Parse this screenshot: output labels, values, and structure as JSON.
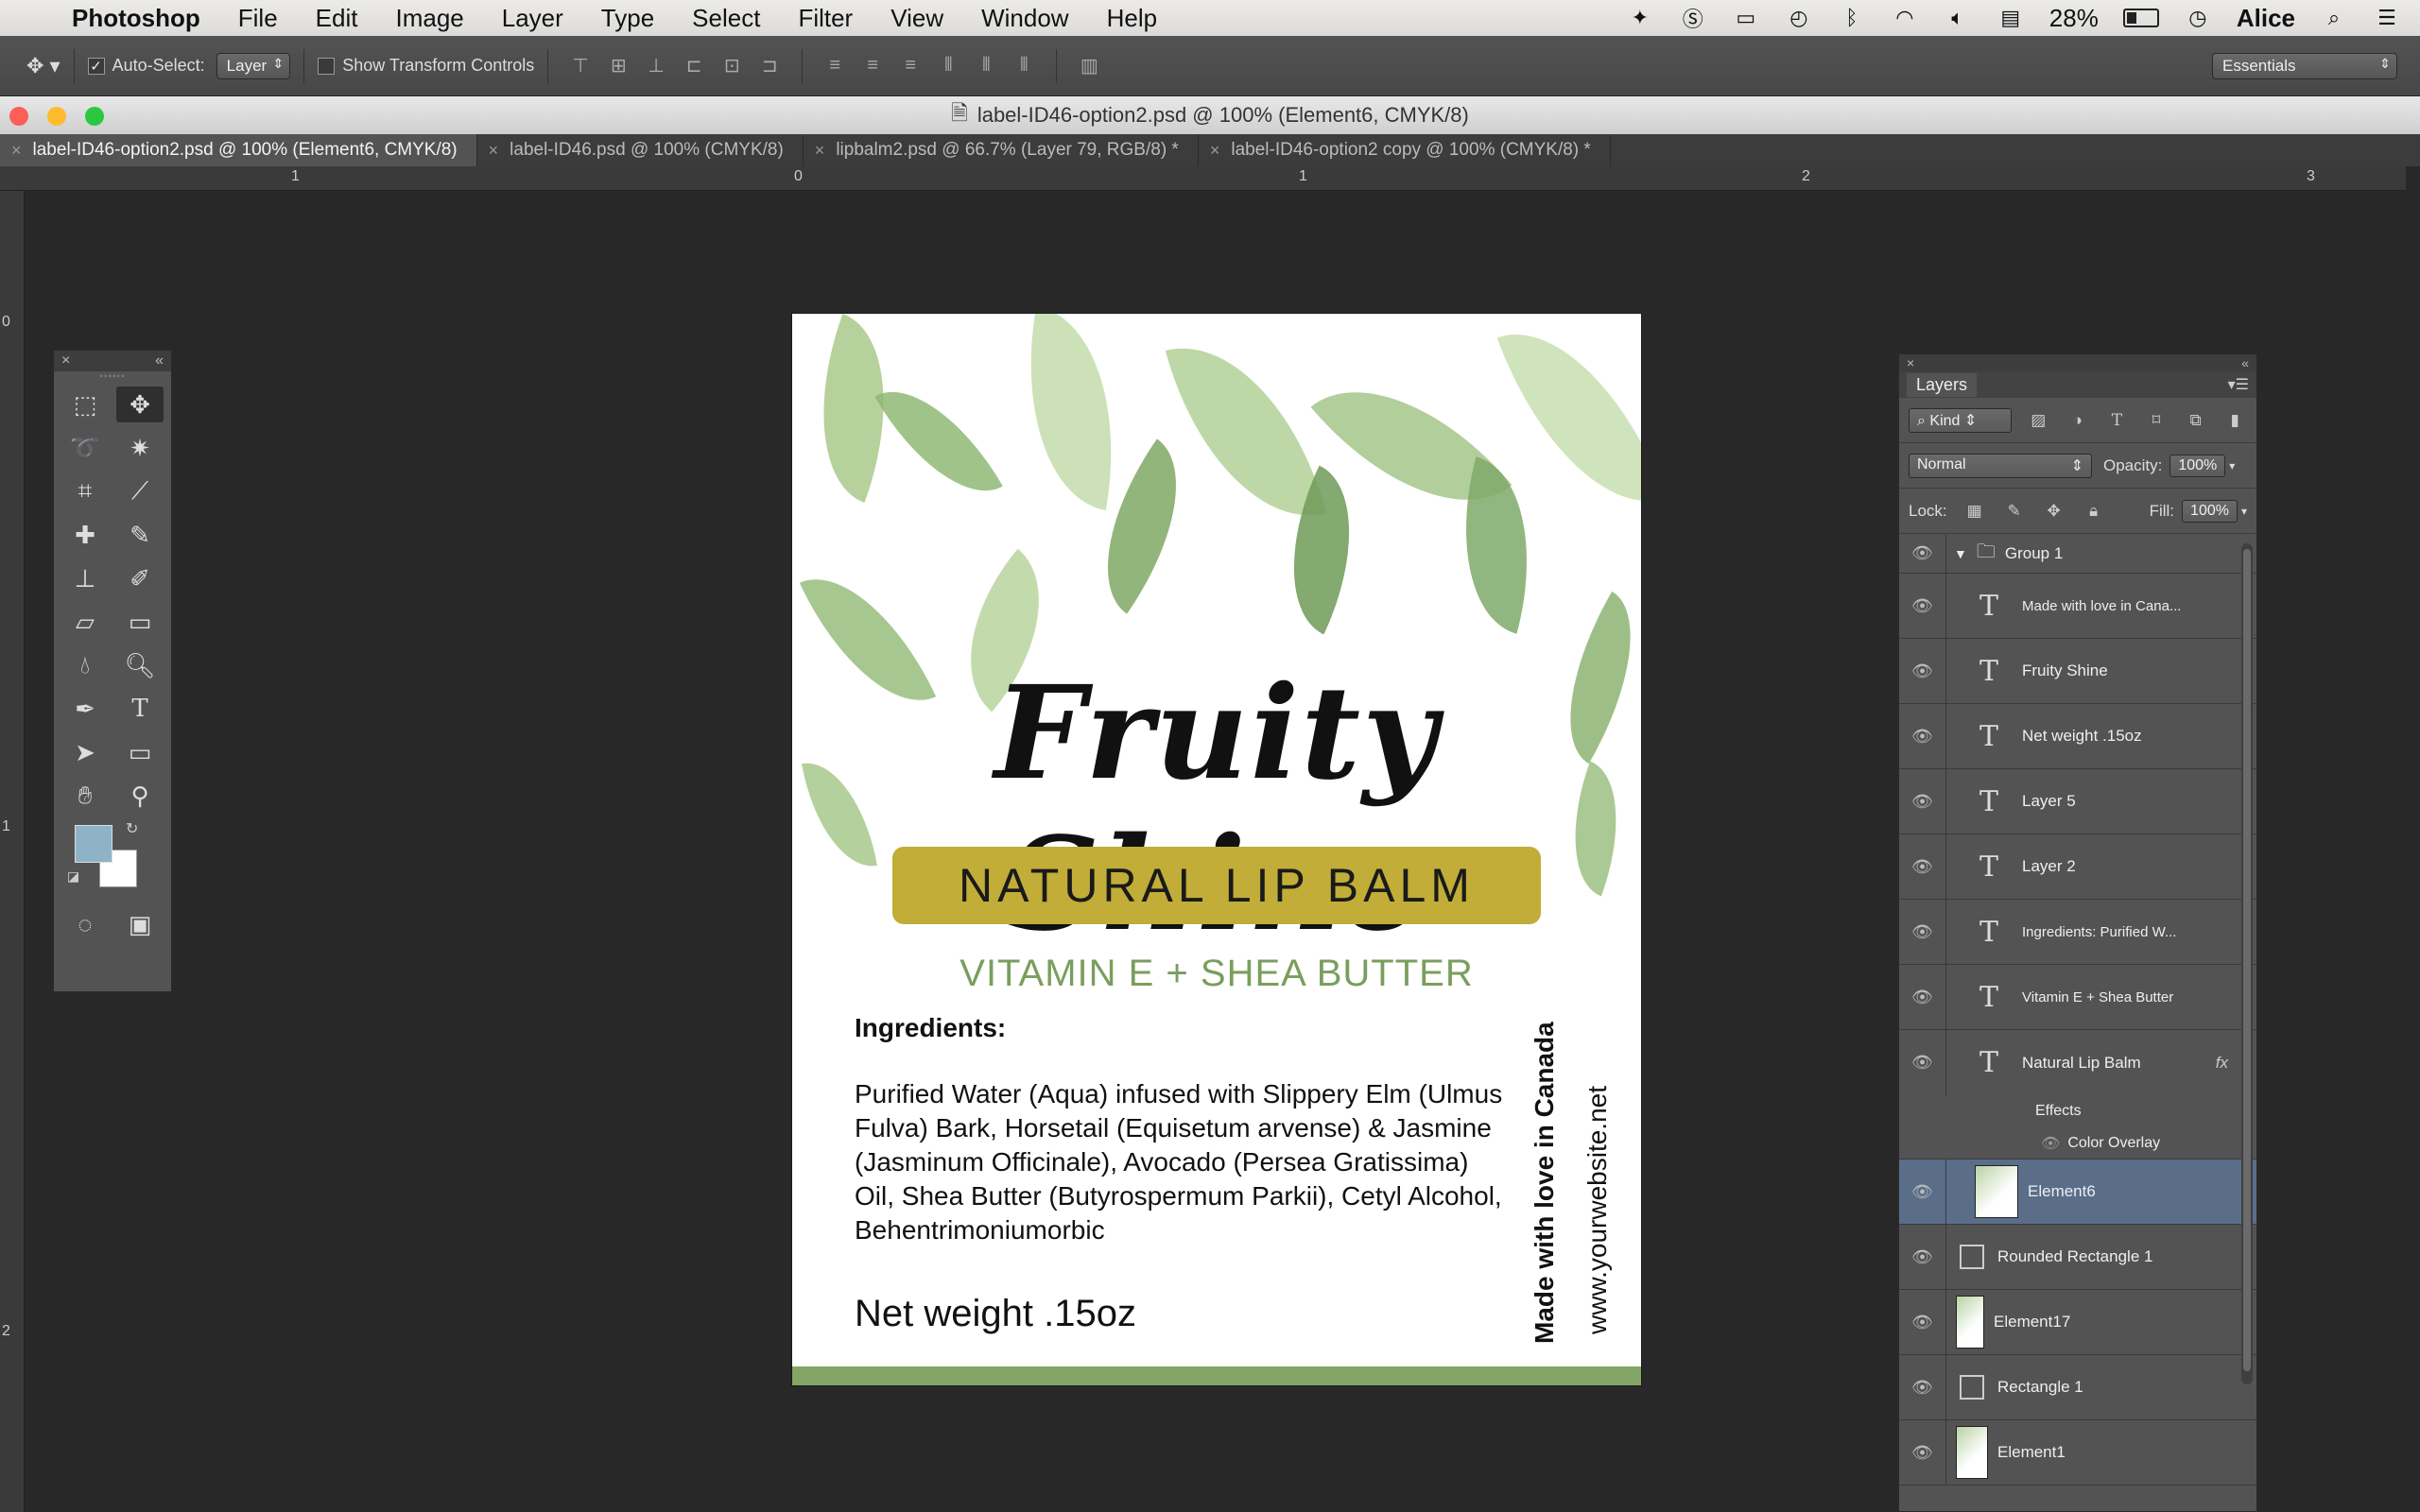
{
  "menubar": {
    "app": "Photoshop",
    "items": [
      "File",
      "Edit",
      "Image",
      "Layer",
      "Type",
      "Select",
      "Filter",
      "View",
      "Window",
      "Help"
    ],
    "battery": "28%",
    "user": "Alice"
  },
  "options": {
    "auto_select_label": "Auto-Select:",
    "auto_select_value": "Layer",
    "transform_label": "Show Transform Controls",
    "workspace": "Essentials"
  },
  "document": {
    "title": "label-ID46-option2.psd @ 100% (Element6, CMYK/8)"
  },
  "tabs": [
    "label-ID46-option2.psd @ 100% (Element6, CMYK/8)",
    "label-ID46.psd @ 100% (CMYK/8)",
    "lipbalm2.psd @ 66.7% (Layer 79, RGB/8) *",
    "label-ID46-option2 copy @ 100% (CMYK/8) *"
  ],
  "rulers": {
    "h": [
      "1",
      "0",
      "1",
      "2",
      "3"
    ],
    "v": [
      "0",
      "1",
      "2"
    ]
  },
  "label": {
    "brand": "Fruity Shine",
    "banner": "NATURAL LIP BALM",
    "subtitle": "VITAMIN E + SHEA BUTTER",
    "ingredients_heading": "Ingredients:",
    "ingredients_text": "Purified Water (Aqua) infused with Slippery Elm (Ulmus Fulva) Bark, Horsetail (Equisetum arvense) &  Jasmine (Jasminum Officinale), Avocado (Persea Gratissima) Oil, Shea Butter (Butyrospermum Parkii), Cetyl Alcohol, Behentrimoniumorbic",
    "net_weight": "Net weight .15oz",
    "made_with_love": "Made with love in Canada",
    "website": "www.yourwebsite.net"
  },
  "layers_panel": {
    "tab": "Layers",
    "kind": "Kind",
    "blend_mode": "Normal",
    "opacity_label": "Opacity:",
    "opacity": "100%",
    "lock_label": "Lock:",
    "fill_label": "Fill:",
    "fill": "100%",
    "group": "Group 1",
    "text_layers": [
      "Made with love in Cana...",
      "Fruity Shine",
      "Net weight .15oz",
      "Layer 5",
      "Layer 2",
      "Ingredients:  Purified W...",
      "Vitamin E + Shea Butter",
      "Natural Lip Balm"
    ],
    "effects_label": "Effects",
    "color_overlay": "Color Overlay",
    "fx": "fx",
    "other_layers": [
      "Element6",
      "Rounded Rectangle 1",
      "Element17",
      "Rectangle 1",
      "Element1"
    ]
  },
  "colors": {
    "foreground_swatch": "#8fb3c6",
    "background_swatch": "#ffffff",
    "banner": "#c1ad38",
    "subtitle": "#7a9e5d",
    "footer": "#83a566"
  }
}
